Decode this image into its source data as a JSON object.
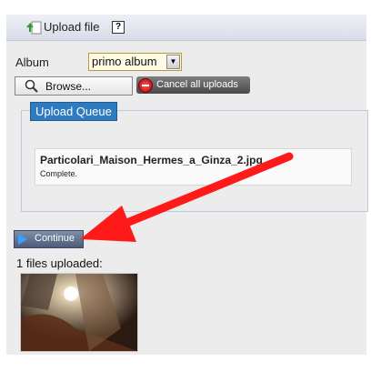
{
  "header": {
    "title": "Upload file",
    "help_label": "?"
  },
  "album": {
    "label": "Album",
    "selected": "primo album"
  },
  "buttons": {
    "browse": "Browse...",
    "cancel_all": "Cancel all uploads",
    "continue": "Continue"
  },
  "queue": {
    "title": "Upload Queue",
    "items": [
      {
        "filename": "Particolari_Maison_Hermes_a_Ginza_2.jpg",
        "status": "Complete."
      }
    ]
  },
  "uploaded_summary": "1 files uploaded:",
  "colors": {
    "accent": "#2f7bbf",
    "annotation_arrow": "#ff1a1a"
  },
  "icons": [
    "upload-icon",
    "help-icon",
    "dropdown-arrow-icon",
    "magnifier-icon",
    "stop-icon",
    "play-icon"
  ]
}
